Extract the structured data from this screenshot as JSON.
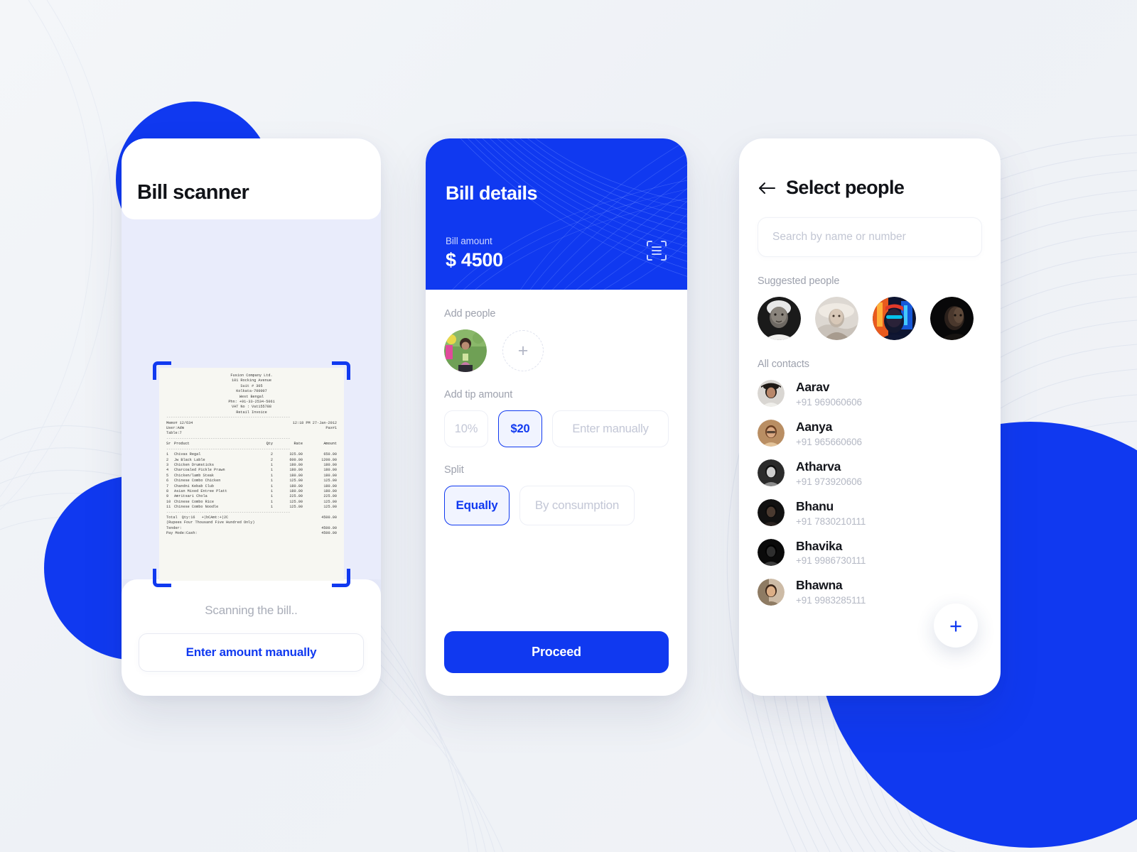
{
  "theme": {
    "brand_blue": "#1039F0",
    "page_bg": "#F2F4F8",
    "scanner_bg": "#E9ECFB",
    "muted_text": "#A9ADB8"
  },
  "scanner": {
    "title": "Bill scanner",
    "status_text": "Scanning the bill..",
    "manual_button": "Enter amount manually",
    "receipt": {
      "company": "Fusion Company Ltd.",
      "address1": "101 Rocking Avenue",
      "address2": "Suit # 305",
      "address3": "Kolkata-700007",
      "address4": "West Bengal",
      "phone": "Phn: +91-33-2534-5061",
      "vat": "VAT No : Vat155788",
      "doc_type": "Retail Invoice",
      "memo": "Memo# 12/634",
      "datetime": "12:18 PM 27-Jan-2012",
      "user": "User:Adm",
      "pax": "Pax#1",
      "table": "Table:7",
      "columns": [
        "Sr",
        "Product",
        "Qty",
        "Rate",
        "Amount"
      ],
      "items": [
        {
          "sr": "1",
          "product": "Chivas Regal",
          "qty": "2",
          "rate": "325.00",
          "amount": "650.00"
        },
        {
          "sr": "2",
          "product": "Jw Black Lable",
          "qty": "2",
          "rate": "600.00",
          "amount": "1200.00"
        },
        {
          "sr": "3",
          "product": "Chicken Drumsticks",
          "qty": "1",
          "rate": "180.00",
          "amount": "180.00"
        },
        {
          "sr": "4",
          "product": "Charcoaled Pickle Prawn",
          "qty": "1",
          "rate": "180.00",
          "amount": "180.00"
        },
        {
          "sr": "5",
          "product": "Chicken/lamb Steak",
          "qty": "1",
          "rate": "180.00",
          "amount": "180.00"
        },
        {
          "sr": "6",
          "product": "Chinese Combo Chicken",
          "qty": "1",
          "rate": "125.00",
          "amount": "125.00"
        },
        {
          "sr": "7",
          "product": "Chandni Kebab Club",
          "qty": "1",
          "rate": "180.00",
          "amount": "180.00"
        },
        {
          "sr": "8",
          "product": "Asian Mixed Entree Platt",
          "qty": "1",
          "rate": "180.00",
          "amount": "180.00"
        },
        {
          "sr": "9",
          "product": "Amritsari Chola",
          "qty": "1",
          "rate": "225.00",
          "amount": "225.00"
        },
        {
          "sr": "10",
          "product": "Chinese Combo Rice",
          "qty": "1",
          "rate": "125.00",
          "amount": "125.00"
        },
        {
          "sr": "11",
          "product": "Chinese Combo Noodle",
          "qty": "1",
          "rate": "125.00",
          "amount": "125.00"
        }
      ],
      "total_line": "Total  Qty:16   +|bCAmt:+|2C",
      "total_amount": "4500.00",
      "amount_words": "(Rupees Four Thousand Five Hundred  Only)",
      "tender_label": "Tender:",
      "tender_amount": "4500.00",
      "paymode_label": "Pay Mode:Cash:",
      "paymode_amount": "4500.00"
    }
  },
  "bill_details": {
    "title": "Bill details",
    "amount_label": "Bill amount",
    "amount_value": "$ 4500",
    "scan_icon": "document-scan-icon",
    "add_people_label": "Add people",
    "add_person_icon": "plus-icon",
    "tip_label": "Add tip amount",
    "tip_options": [
      {
        "label": "10%",
        "selected": false
      },
      {
        "label": "$20",
        "selected": true
      },
      {
        "label": "Enter manually",
        "selected": false
      }
    ],
    "split_label": "Split",
    "split_options": [
      {
        "label": "Equally",
        "selected": true
      },
      {
        "label": "By consumption",
        "selected": false
      }
    ],
    "proceed_button": "Proceed"
  },
  "select_people": {
    "back_icon": "arrow-left-icon",
    "title": "Select people",
    "search_placeholder": "Search by name or number",
    "search_value": "",
    "suggested_label": "Suggested people",
    "suggested_count": 4,
    "all_contacts_label": "All contacts",
    "contacts": [
      {
        "name": "Aarav",
        "phone": "+91 969060606"
      },
      {
        "name": "Aanya",
        "phone": "+91 965660606"
      },
      {
        "name": "Atharva",
        "phone": "+91 973920606"
      },
      {
        "name": "Bhanu",
        "phone": "+91 7830210111"
      },
      {
        "name": "Bhavika",
        "phone": "+91 9986730111"
      },
      {
        "name": "Bhawna",
        "phone": "+91 9983285111"
      }
    ],
    "fab_icon": "plus-icon"
  }
}
